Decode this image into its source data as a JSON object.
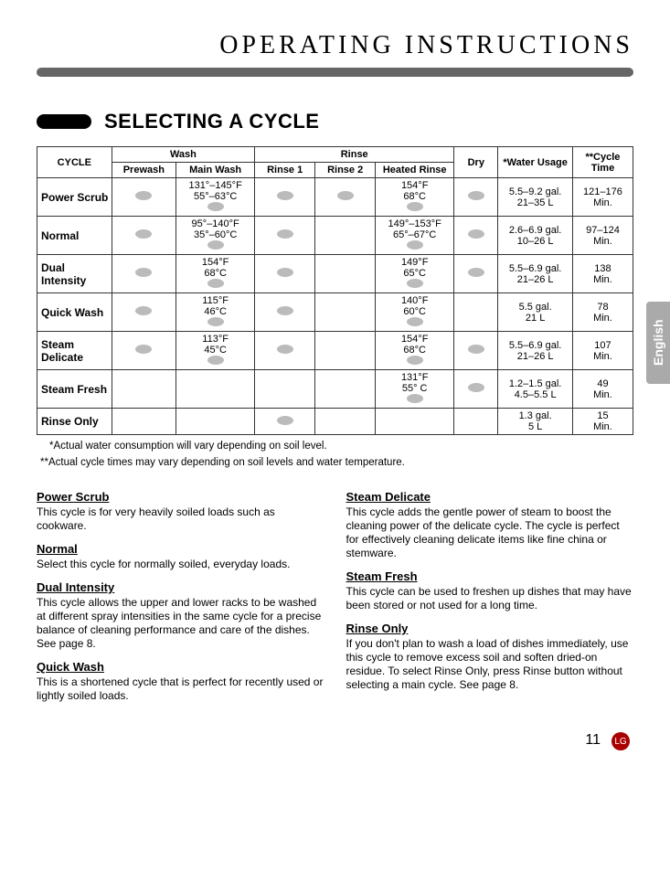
{
  "header": {
    "title": "OPERATING INSTRUCTIONS"
  },
  "section": {
    "title": "SELECTING A CYCLE"
  },
  "table": {
    "headers": {
      "cycle": "CYCLE",
      "wash": "Wash",
      "rinse": "Rinse",
      "dry": "Dry",
      "water": "*Water Usage",
      "time": "**Cycle Time",
      "prewash": "Prewash",
      "mainwash": "Main Wash",
      "rinse1": "Rinse 1",
      "rinse2": "Rinse 2",
      "heated": "Heated Rinse"
    },
    "rows": [
      {
        "label": "Power Scrub",
        "prewash": "dot",
        "mainwash_t": "131°–145°F\n55°–63°C",
        "mainwash_d": "dot",
        "rinse1": "dot",
        "rinse2": "dot",
        "heated_t": "154°F\n68°C",
        "heated_d": "dot",
        "dry": "dot",
        "water": "5.5–9.2 gal.\n21–35 L",
        "time": "121–176\nMin."
      },
      {
        "label": "Normal",
        "prewash": "dot",
        "mainwash_t": "95°–140°F\n35°–60°C",
        "mainwash_d": "dot",
        "rinse1": "dot",
        "rinse2": "",
        "heated_t": "149°–153°F\n65°–67°C",
        "heated_d": "dot",
        "dry": "dot",
        "water": "2.6–6.9 gal.\n10–26 L",
        "time": "97–124\nMin."
      },
      {
        "label": "Dual Intensity",
        "prewash": "dot",
        "mainwash_t": "154°F\n68°C",
        "mainwash_d": "dot",
        "rinse1": "dot",
        "rinse2": "",
        "heated_t": "149°F\n65°C",
        "heated_d": "dot",
        "dry": "dot",
        "water": "5.5–6.9 gal.\n21–26 L",
        "time": "138\nMin."
      },
      {
        "label": "Quick Wash",
        "prewash": "dot",
        "mainwash_t": "115°F\n46°C",
        "mainwash_d": "dot",
        "rinse1": "dot",
        "rinse2": "",
        "heated_t": "140°F\n60°C",
        "heated_d": "dot",
        "dry": "",
        "water": "5.5 gal.\n21 L",
        "time": "78\nMin."
      },
      {
        "label": "Steam Delicate",
        "prewash": "dot",
        "mainwash_t": "113°F\n45°C",
        "mainwash_d": "dot",
        "rinse1": "dot",
        "rinse2": "",
        "heated_t": "154°F\n68°C",
        "heated_d": "dot",
        "dry": "dot",
        "water": "5.5–6.9 gal.\n21–26 L",
        "time": "107\nMin."
      },
      {
        "label": "Steam Fresh",
        "prewash": "",
        "mainwash_t": "",
        "mainwash_d": "",
        "rinse1": "",
        "rinse2": "",
        "heated_t": "131°F\n55° C",
        "heated_d": "dot",
        "dry": "dot",
        "water": "1.2–1.5 gal.\n4.5–5.5 L",
        "time": "49\nMin."
      },
      {
        "label": "Rinse Only",
        "prewash": "",
        "mainwash_t": "",
        "mainwash_d": "",
        "rinse1": "dot",
        "rinse2": "",
        "heated_t": "",
        "heated_d": "",
        "dry": "",
        "water": "1.3 gal.\n5 L",
        "time": "15\nMin."
      }
    ]
  },
  "notes": {
    "water": "*Actual water consumption will vary depending on soil level.",
    "time": "**Actual cycle times may vary depending on soil levels and water temperature."
  },
  "descriptions": {
    "left": [
      {
        "title": "Power Scrub",
        "body": "This cycle is for very heavily soiled loads such as cookware."
      },
      {
        "title": "Normal",
        "body": "Select this cycle for normally soiled, everyday loads."
      },
      {
        "title": "Dual Intensity",
        "body": "This cycle allows the upper and lower racks to be washed at different spray intensities in the same cycle for a precise balance of cleaning performance and care of the dishes. See page 8."
      },
      {
        "title": "Quick Wash",
        "body": "This is a shortened cycle that is perfect for recently used or lightly soiled loads."
      }
    ],
    "right": [
      {
        "title": "Steam Delicate",
        "body": "This cycle adds the gentle power of steam to boost the cleaning power of the delicate cycle. The cycle is perfect for effectively cleaning delicate items like fine china or stemware."
      },
      {
        "title": "Steam Fresh",
        "body": "This cycle can be used to freshen up dishes that may have been stored or not used for a long time."
      },
      {
        "title": "Rinse Only",
        "body": "If you don't plan to wash a load of dishes immediately, use this cycle to remove excess soil and soften dried-on residue. To select Rinse Only, press Rinse button without selecting a main cycle. See page 8."
      }
    ]
  },
  "sidetab": "English",
  "pagenum": "11",
  "logo": "LG"
}
